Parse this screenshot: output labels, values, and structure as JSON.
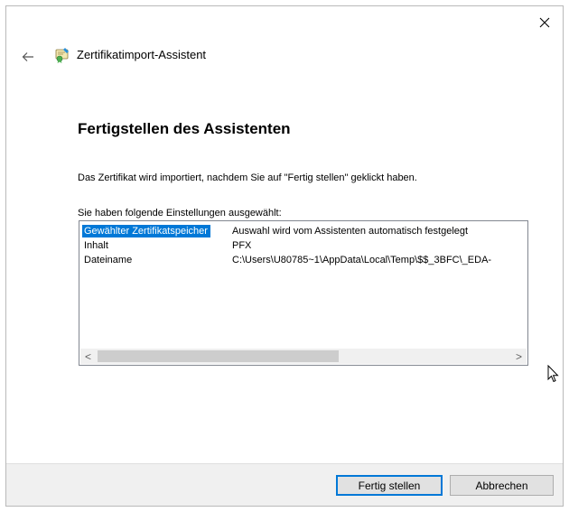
{
  "wizard": {
    "title": "Zertifikatimport-Assistent",
    "heading": "Fertigstellen des Assistenten",
    "description": "Das Zertifikat wird importiert, nachdem Sie auf \"Fertig stellen\" geklickt haben.",
    "settings_label": "Sie haben folgende Einstellungen ausgewählt:"
  },
  "settings": [
    {
      "name": "Gewählter Zertifikatspeicher",
      "value": "Auswahl wird vom Assistenten automatisch festgelegt",
      "selected": true
    },
    {
      "name": "Inhalt",
      "value": "PFX",
      "selected": false
    },
    {
      "name": "Dateiname",
      "value": "C:\\Users\\U80785~1\\AppData\\Local\\Temp\\$$_3BFC\\_EDA-",
      "selected": false
    }
  ],
  "scrollbar": {
    "left_arrow": "<",
    "right_arrow": ">",
    "position": 0
  },
  "buttons": {
    "finish": "Fertig stellen",
    "cancel": "Abbrechen"
  },
  "icons": {
    "close": "close-icon",
    "back": "back-arrow-icon",
    "app": "certificate-icon",
    "cursor": "mouse-cursor-icon"
  },
  "colors": {
    "selection": "#0078d7",
    "footer": "#f0f0f0",
    "default_button_border": "#0078d7"
  }
}
